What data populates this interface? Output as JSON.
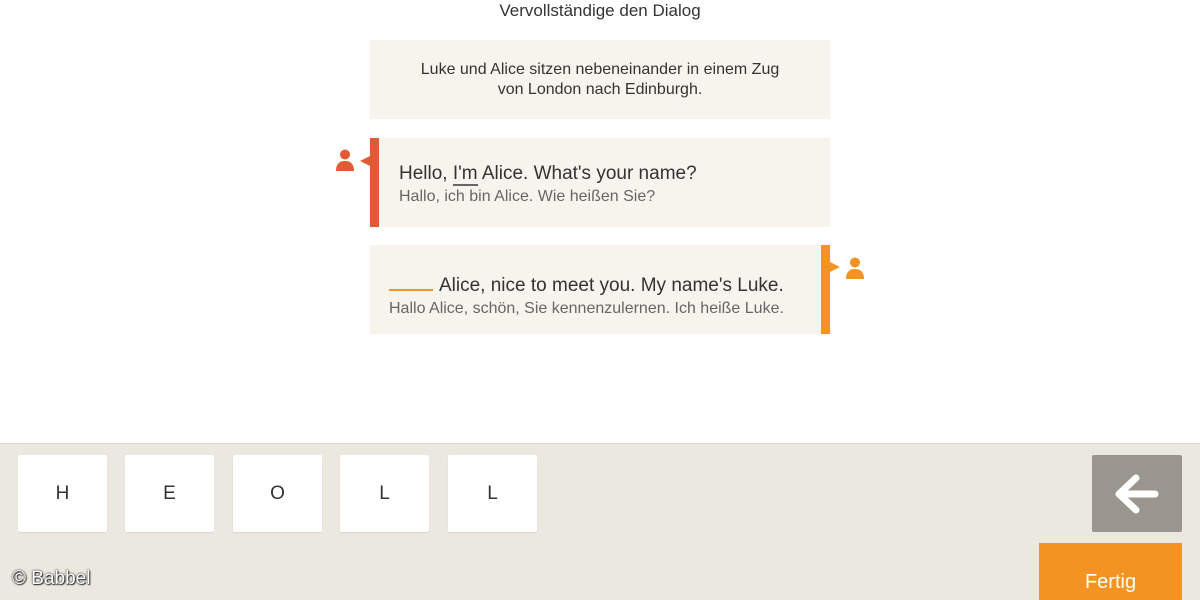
{
  "instruction": "Vervollständige den Dialog",
  "context": "Luke und Alice sitzen nebeneinander in einem Zug von London nach Edinburgh.",
  "dialog": [
    {
      "speaker_icon": "person-icon",
      "color": "#e05a33",
      "en_before": "Hello, ",
      "en_underlined": "I'm",
      "en_after": " Alice. What's your name?",
      "de": "Hallo, ich bin Alice. Wie heißen Sie?"
    },
    {
      "speaker_icon": "person-icon",
      "color": "#f39322",
      "en_after_gap": "Alice, nice to meet you. My name's Luke.",
      "de": "Hallo Alice, schön, Sie kennenzulernen. Ich heiße Luke."
    }
  ],
  "letters": [
    "H",
    "E",
    "O",
    "L",
    "L"
  ],
  "backspace_icon": "arrow-left-icon",
  "done_label": "Fertig",
  "watermark": "© Babbel",
  "colors": {
    "accent_orange": "#f39322",
    "accent_red": "#e05a33",
    "panel": "#f6f4ed",
    "keyboard_bg": "#ebe8df",
    "backspace_bg": "#9a968d"
  }
}
